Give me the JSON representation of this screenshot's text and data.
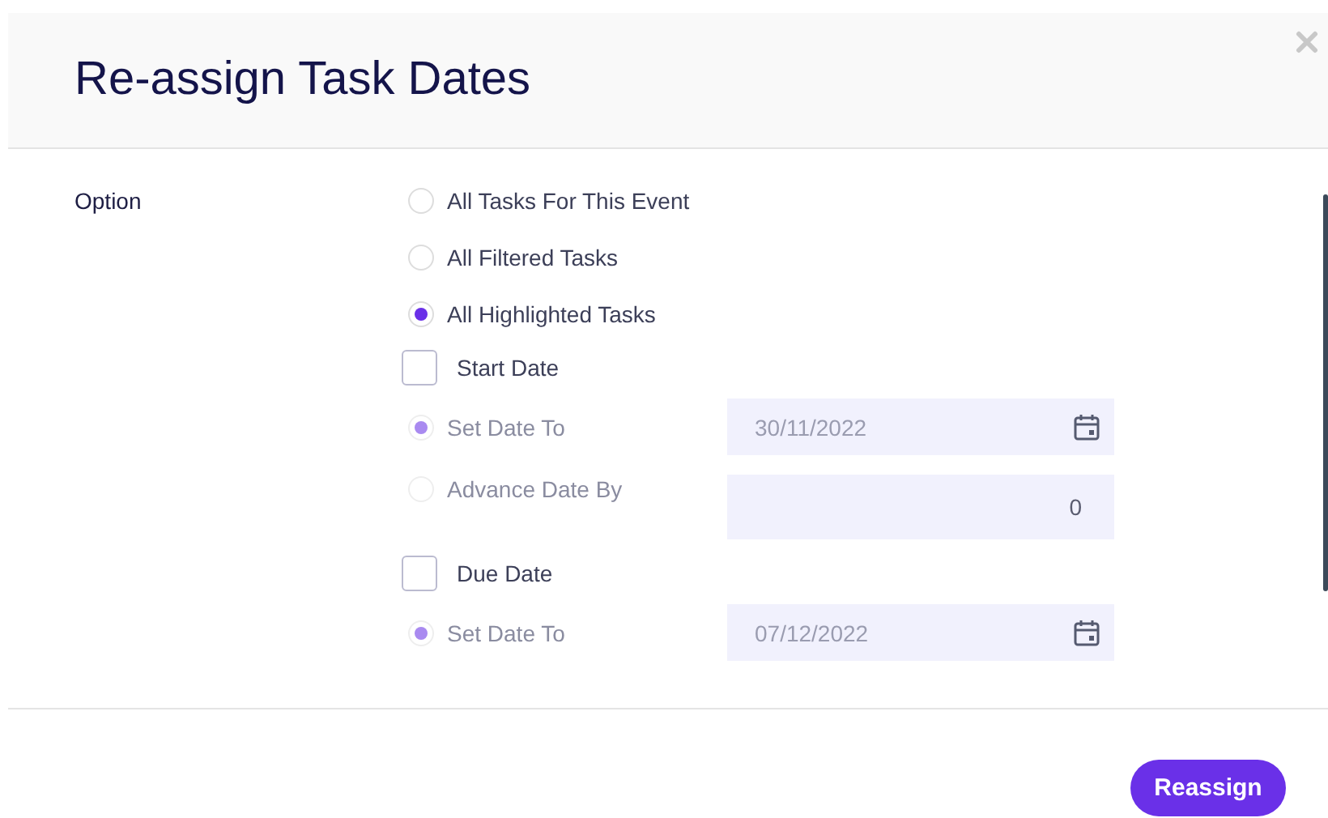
{
  "dialog": {
    "title": "Re-assign Task Dates"
  },
  "option_label": "Option",
  "scope": [
    {
      "label": "All Tasks For This Event",
      "selected": false
    },
    {
      "label": "All Filtered Tasks",
      "selected": false
    },
    {
      "label": "All Highlighted Tasks",
      "selected": true
    }
  ],
  "date_groups": [
    {
      "label": "Start Date",
      "checked": false,
      "modes": [
        {
          "label": "Set Date To",
          "selected": true,
          "disabled": true,
          "field": {
            "kind": "date",
            "value": "30/11/2022"
          }
        },
        {
          "label": "Advance Date By",
          "selected": false,
          "disabled": true,
          "field": {
            "kind": "number",
            "value": "0"
          }
        }
      ]
    },
    {
      "label": "Due Date",
      "checked": false,
      "modes": [
        {
          "label": "Set Date To",
          "selected": true,
          "disabled": true,
          "field": {
            "kind": "date",
            "value": "07/12/2022"
          }
        }
      ]
    }
  ],
  "buttons": [
    {
      "label": "Reassign"
    }
  ]
}
